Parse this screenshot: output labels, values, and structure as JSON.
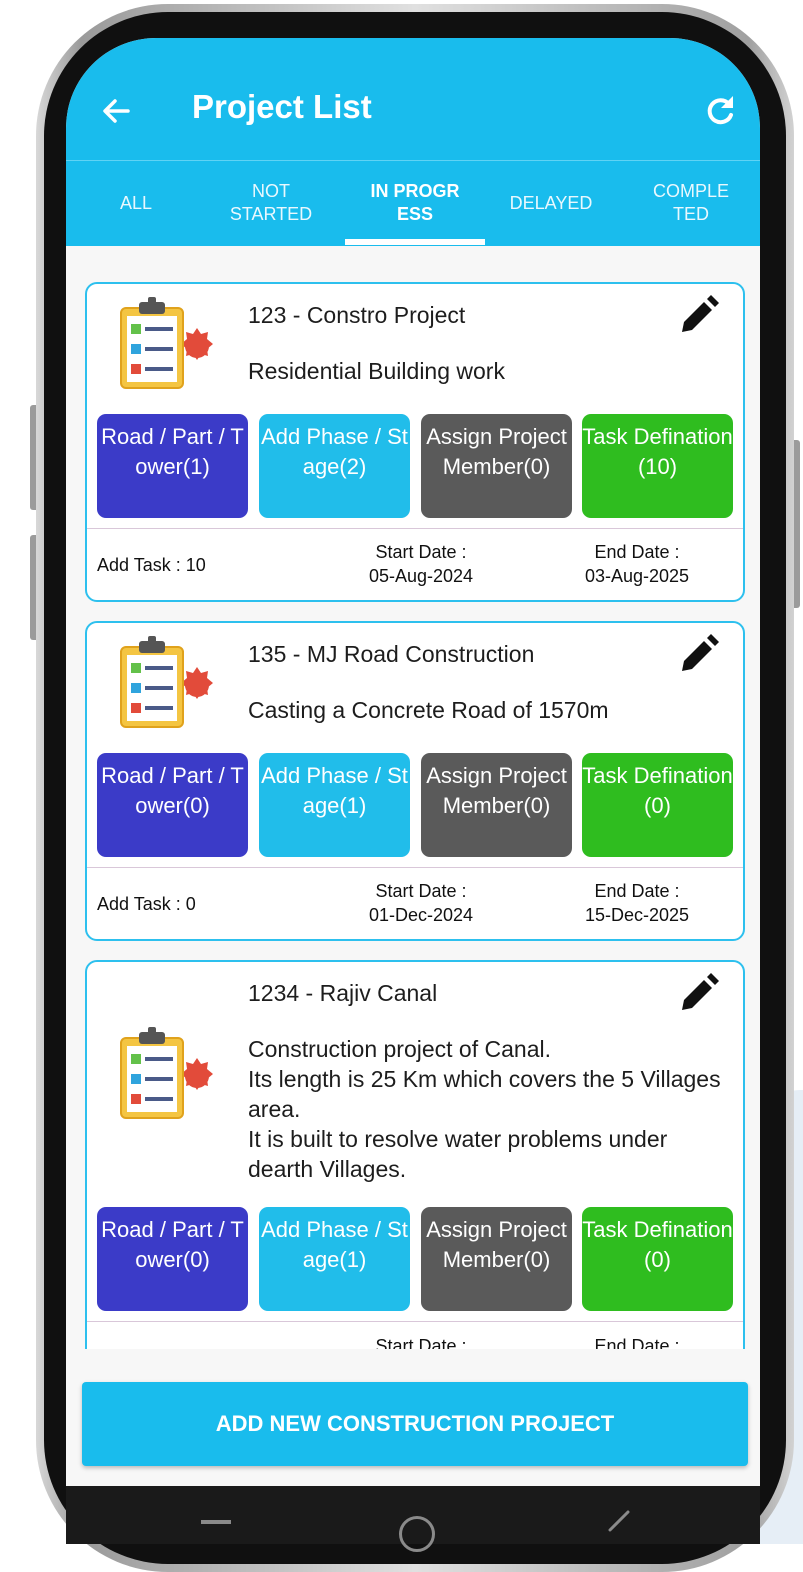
{
  "header": {
    "title": "Project List"
  },
  "tabs": [
    {
      "label": "ALL",
      "active": false
    },
    {
      "label": "NOT\nSTARTED",
      "active": false
    },
    {
      "label": "IN PROGR\nESS",
      "active": true
    },
    {
      "label": "DELAYED",
      "active": false
    },
    {
      "label": "COMPLE\nTED",
      "active": false
    }
  ],
  "projects": [
    {
      "title": "123 - Constro Project",
      "description": "Residential Building work",
      "buttons": [
        "Road / Part / Tower(1)",
        "Add Phase / Stage(2)",
        "Assign Project Member(0)",
        "Task Defination(10)"
      ],
      "add_task": "Add Task : 10",
      "start_label": "Start Date :",
      "start_date": "05-Aug-2024",
      "end_label": "End Date :",
      "end_date": "03-Aug-2025"
    },
    {
      "title": "135 - MJ Road Construction",
      "description": "Casting a Concrete Road of 1570m",
      "buttons": [
        "Road / Part / Tower(0)",
        "Add Phase / Stage(1)",
        "Assign Project Member(0)",
        "Task Defination(0)"
      ],
      "add_task": "Add Task : 0",
      "start_label": "Start Date :",
      "start_date": "01-Dec-2024",
      "end_label": "End Date :",
      "end_date": "15-Dec-2025"
    },
    {
      "title": "1234 - Rajiv Canal",
      "description": "Construction project of Canal.\nIts length is 25 Km which covers the 5 Villages area.\nIt is built to resolve water problems under dearth Villages.",
      "buttons": [
        "Road / Part / Tower(0)",
        "Add Phase / Stage(1)",
        "Assign Project Member(0)",
        "Task Defination(0)"
      ],
      "start_label": "Start Date :",
      "end_label": "End Date :"
    }
  ],
  "add_button": "ADD NEW CONSTRUCTION PROJECT",
  "colors": {
    "primary": "#19bced",
    "road_button": "#3b3bc8",
    "phase_button": "#21bdea",
    "assign_button": "#5a5a5a",
    "task_button": "#2fbd1f"
  }
}
